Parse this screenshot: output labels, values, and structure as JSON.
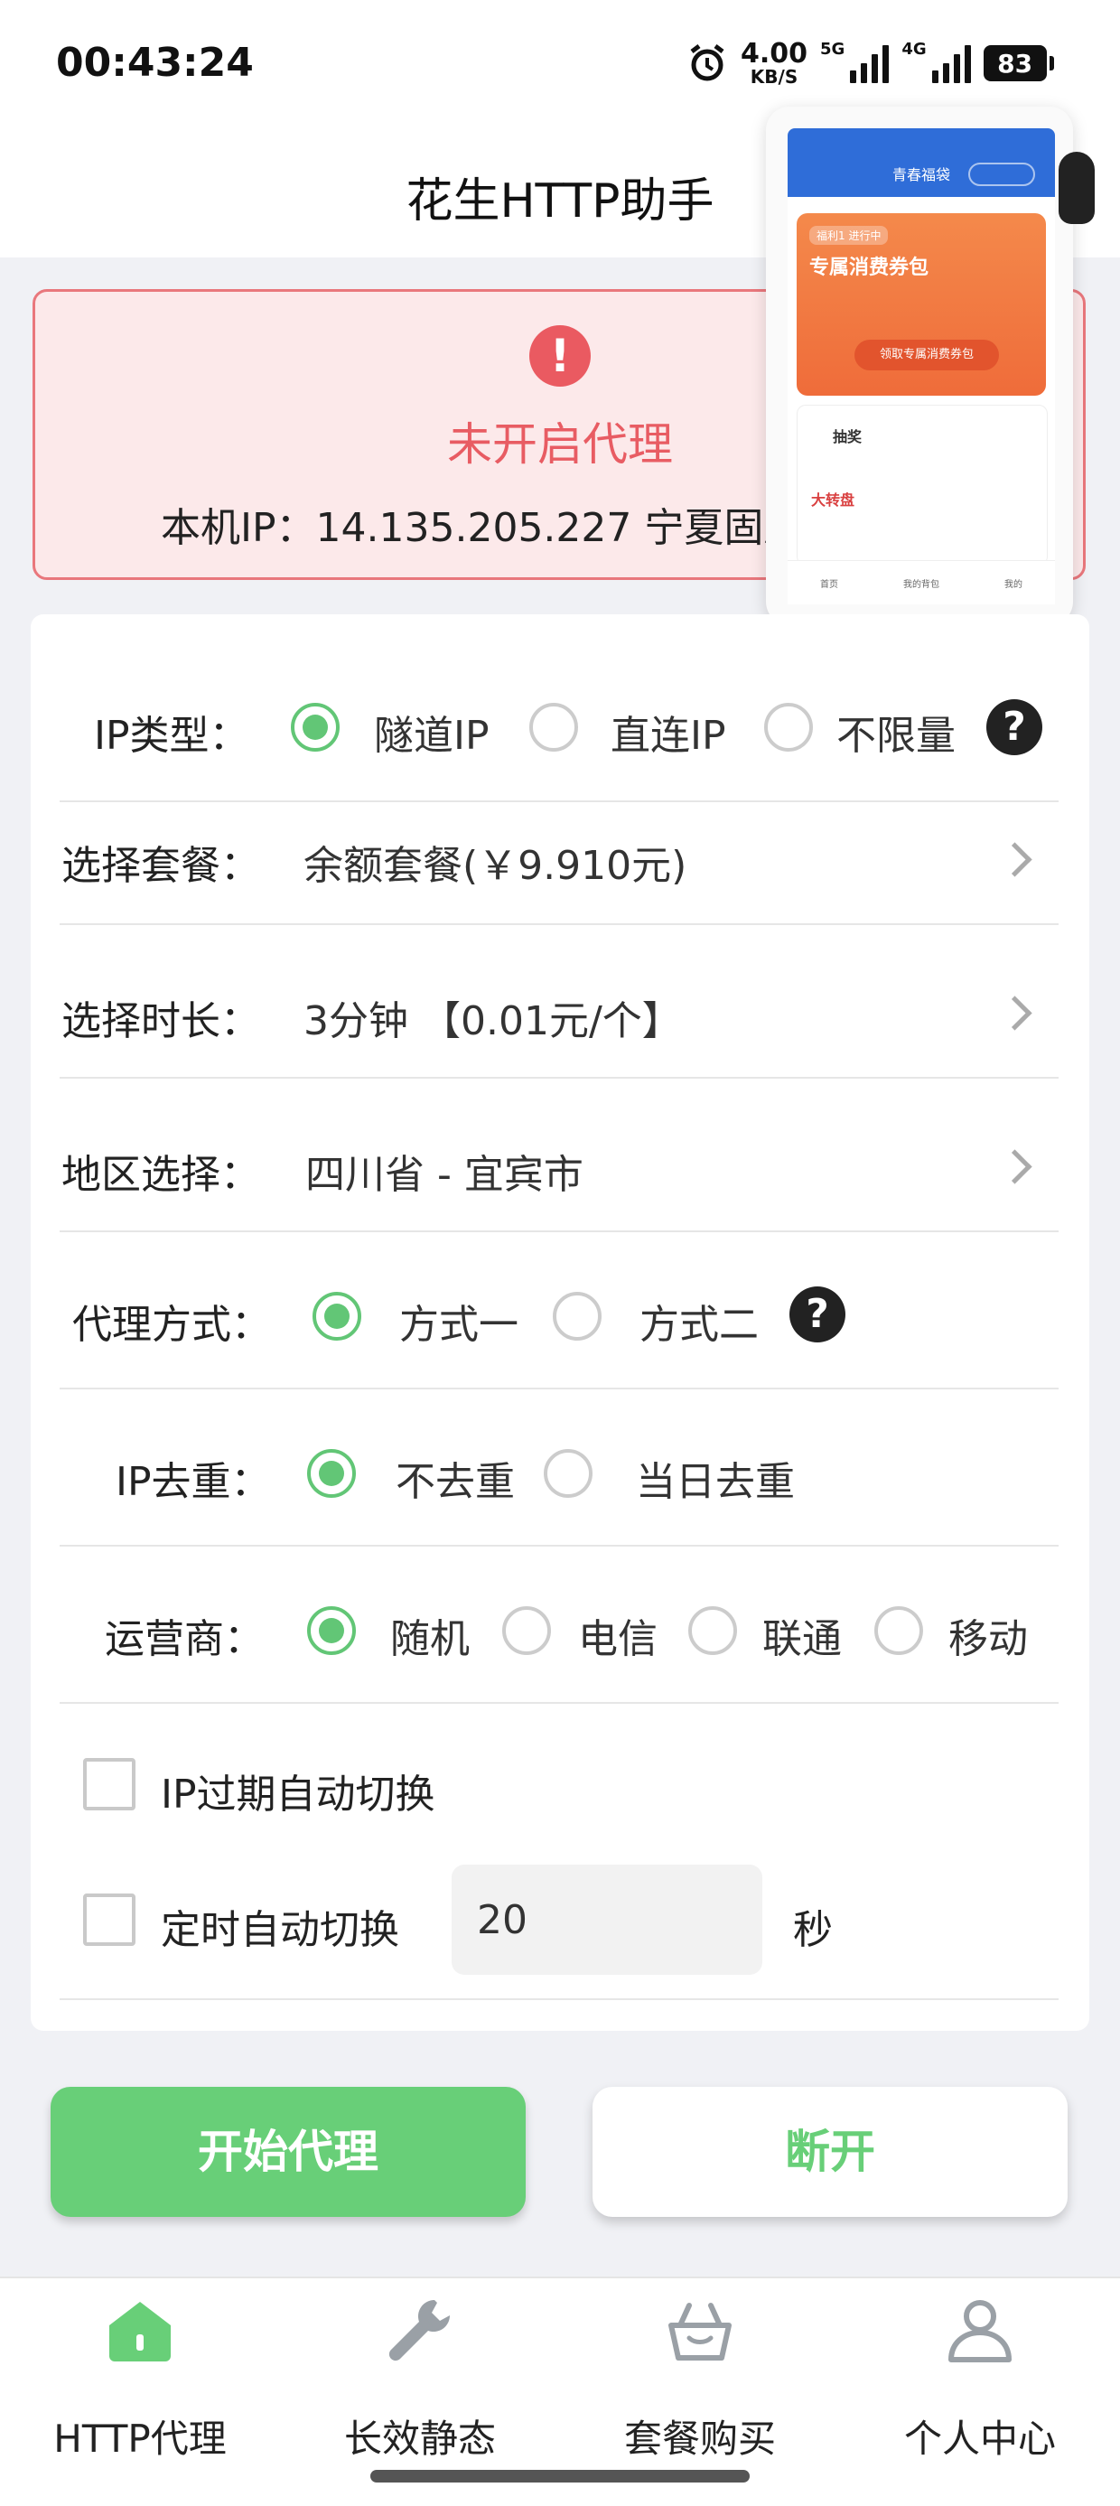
{
  "status_bar": {
    "time": "00:43:24",
    "net_speed": "4.00",
    "net_unit": "KB/S",
    "signal1_label": "5G",
    "signal2_label": "4G",
    "battery": "83"
  },
  "header": {
    "title": "花生HTTP助手"
  },
  "alert": {
    "icon": "!",
    "title": "未开启代理",
    "ip_text": "本机IP：14.135.205.227  宁夏固原"
  },
  "mini_program": {
    "title": "青春福袋",
    "card1_tag": "福利1  进行中",
    "card1_title": "专属消费券包",
    "card1_button": "领取专属消费券包",
    "card2_title": "抽奖",
    "card2_sub": "大转盘",
    "tabs": [
      "首页",
      "我的背包",
      "我的"
    ]
  },
  "form": {
    "ip_type": {
      "label": "IP类型：",
      "options": [
        "隧道IP",
        "直连IP",
        "不限量"
      ],
      "selected": 0
    },
    "package": {
      "label": "选择套餐：",
      "value": "余额套餐(￥9.910元)"
    },
    "duration": {
      "label": "选择时长：",
      "value": "3分钟  【0.01元/个】"
    },
    "region": {
      "label": "地区选择：",
      "value": "四川省 - 宜宾市"
    },
    "proxy_mode": {
      "label": "代理方式：",
      "options": [
        "方式一",
        "方式二"
      ],
      "selected": 0
    },
    "dedup": {
      "label": "IP去重：",
      "options": [
        "不去重",
        "当日去重"
      ],
      "selected": 0
    },
    "carrier": {
      "label": "运营商：",
      "options": [
        "随机",
        "电信",
        "联通",
        "移动"
      ],
      "selected": 0
    },
    "auto_switch_expire": {
      "label": "IP过期自动切换",
      "checked": false
    },
    "auto_switch_timer": {
      "label": "定时自动切换",
      "checked": false,
      "value": "20",
      "unit": "秒"
    }
  },
  "actions": {
    "start": "开始代理",
    "stop": "断开"
  },
  "nav": {
    "items": [
      "HTTP代理",
      "长效静态",
      "套餐购买",
      "个人中心"
    ],
    "active": 0
  },
  "colors": {
    "accent": "#68cf78",
    "alert": "#e85c63",
    "alert_bg": "#fce9ea"
  }
}
